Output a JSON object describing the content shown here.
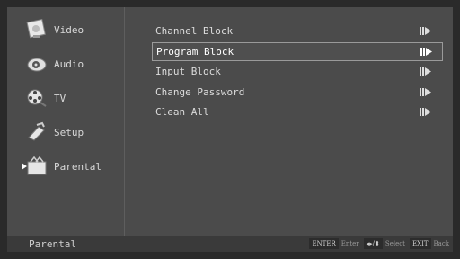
{
  "sidebar": {
    "items": [
      {
        "label": "Video",
        "icon": "video-icon"
      },
      {
        "label": "Audio",
        "icon": "audio-icon"
      },
      {
        "label": "TV",
        "icon": "tv-icon"
      },
      {
        "label": "Setup",
        "icon": "setup-icon"
      },
      {
        "label": "Parental",
        "icon": "parental-icon",
        "active": true
      }
    ]
  },
  "menu": {
    "items": [
      {
        "label": "Channel Block"
      },
      {
        "label": "Program Block",
        "selected": true
      },
      {
        "label": "Input Block"
      },
      {
        "label": "Change Password"
      },
      {
        "label": "Clean All"
      }
    ]
  },
  "footer": {
    "title": "Parental",
    "enter_key": "ENTER",
    "enter_hint": "Enter",
    "nav_key": "◂▸/⬍",
    "select_hint": "Select",
    "exit_key": "EXIT",
    "back_hint": "Back"
  },
  "colors": {
    "background": "#4b4b4b",
    "footer": "#3a3a3a",
    "text": "#dcdcdc"
  }
}
